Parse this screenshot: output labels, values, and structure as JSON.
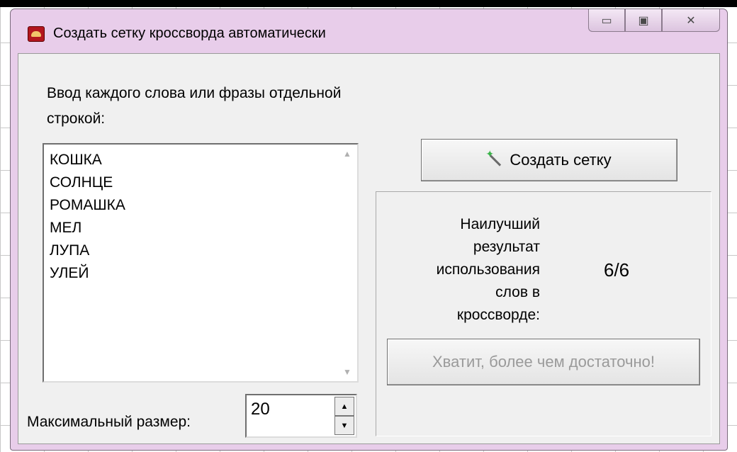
{
  "window": {
    "title": "Создать сетку кроссворда автоматически",
    "icon": "app-icon",
    "controls": [
      "minimize-icon",
      "maximize-icon",
      "close-icon"
    ]
  },
  "prompt": "Ввод каждого слова или фразы отдельной строкой:",
  "words": [
    "КОШКА",
    "СОЛНЦЕ",
    "РОМАШКА",
    "МЕЛ",
    "ЛУПА",
    "УЛЕЙ"
  ],
  "max_size": {
    "label": "Максимальный размер:",
    "value": "20"
  },
  "create_button": {
    "label": "Создать сетку",
    "icon": "magic-wand-icon"
  },
  "result": {
    "label": "Наилучший\nрезультат\nиспользования\nслов в\nкроссворде:",
    "value": "6/6"
  },
  "stop_button": {
    "label": "Хватит, более чем достаточно!",
    "enabled": false
  },
  "colors": {
    "frame": "#e8cdea",
    "client": "#f0f0f0",
    "disabled_text": "#9a9a9a"
  }
}
